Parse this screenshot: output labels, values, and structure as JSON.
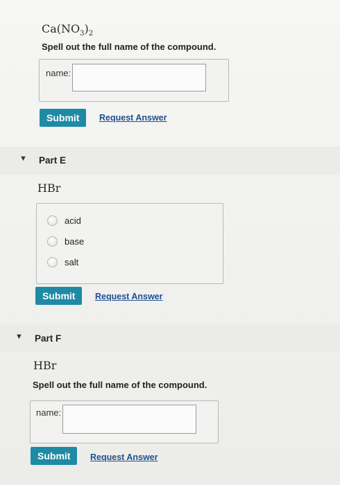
{
  "part_d": {
    "formula_main": "Ca(NO",
    "formula_sub": "3",
    "formula_close": ")",
    "formula_sub2": "2",
    "instruction": "Spell out the full name of the compound.",
    "field_label": "name:",
    "field_value": "",
    "submit_label": "Submit",
    "request_label": "Request Answer"
  },
  "part_e": {
    "toggle_icon": "triangle-down-icon",
    "title": "Part E",
    "formula": "HBr",
    "options": [
      {
        "label": "acid"
      },
      {
        "label": "base"
      },
      {
        "label": "salt"
      }
    ],
    "submit_label": "Submit",
    "request_label": "Request Answer"
  },
  "part_f": {
    "toggle_icon": "triangle-down-icon",
    "title": "Part F",
    "formula": "HBr",
    "instruction": "Spell out the full name of the compound.",
    "field_label": "name:",
    "field_value": "",
    "submit_label": "Submit",
    "request_label": "Request Answer"
  },
  "colors": {
    "submit_bg": "#1f8aa5",
    "link": "#1f4f8f",
    "background": "#f4f4f2"
  }
}
